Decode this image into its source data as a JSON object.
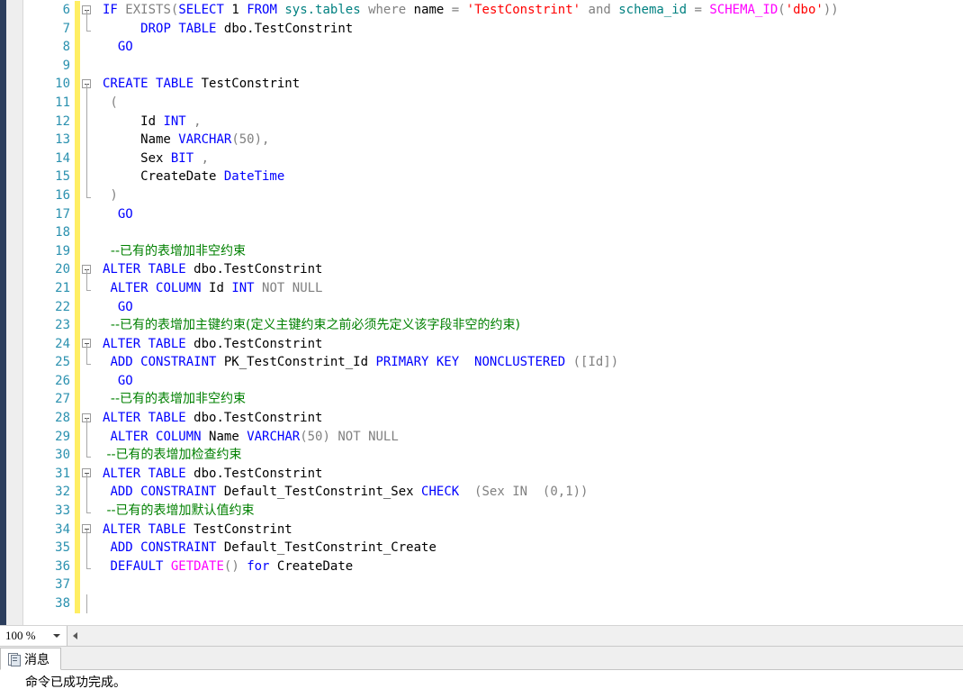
{
  "editor": {
    "first_line_number": 6,
    "gutter_change_color": "#ffee62",
    "line_number_color": "#2b91af",
    "colors": {
      "keyword": "#0000ff",
      "string": "#ff0000",
      "comment": "#008000",
      "function": "#ff00ff",
      "system_object": "#008080",
      "operator_gray": "#808080",
      "plain": "#000000"
    },
    "lines": [
      {
        "number": 6,
        "fold": "start",
        "tokens": [
          {
            "t": "IF ",
            "c": "kw"
          },
          {
            "t": "EXISTS(",
            "c": "gray"
          },
          {
            "t": "SELECT ",
            "c": "kw"
          },
          {
            "t": "1 ",
            "c": "plain"
          },
          {
            "t": "FROM ",
            "c": "kw"
          },
          {
            "t": "sys.tables ",
            "c": "sysobj"
          },
          {
            "t": "where ",
            "c": "gray"
          },
          {
            "t": "name ",
            "c": "plain"
          },
          {
            "t": "= ",
            "c": "gray"
          },
          {
            "t": "'TestConstrint' ",
            "c": "str"
          },
          {
            "t": "and ",
            "c": "gray"
          },
          {
            "t": "schema_id ",
            "c": "sysobj"
          },
          {
            "t": "= ",
            "c": "gray"
          },
          {
            "t": "SCHEMA_ID",
            "c": "fn"
          },
          {
            "t": "(",
            "c": "gray"
          },
          {
            "t": "'dbo'",
            "c": "str"
          },
          {
            "t": "))",
            "c": "gray"
          }
        ]
      },
      {
        "number": 7,
        "fold": "end",
        "tokens": [
          {
            "t": "     ",
            "c": "plain"
          },
          {
            "t": "DROP ",
            "c": "kw"
          },
          {
            "t": "TABLE ",
            "c": "kw"
          },
          {
            "t": "dbo.TestConstrint",
            "c": "plain"
          }
        ]
      },
      {
        "number": 8,
        "fold": "none",
        "tokens": [
          {
            "t": "  ",
            "c": "plain"
          },
          {
            "t": "GO",
            "c": "kw"
          }
        ]
      },
      {
        "number": 9,
        "fold": "none",
        "tokens": []
      },
      {
        "number": 10,
        "fold": "start",
        "tokens": [
          {
            "t": "CREATE ",
            "c": "kw"
          },
          {
            "t": "TABLE ",
            "c": "kw"
          },
          {
            "t": "TestConstrint",
            "c": "plain"
          }
        ]
      },
      {
        "number": 11,
        "fold": "bar",
        "tokens": [
          {
            "t": " (",
            "c": "gray"
          }
        ]
      },
      {
        "number": 12,
        "fold": "bar",
        "tokens": [
          {
            "t": "     Id ",
            "c": "plain"
          },
          {
            "t": "INT ",
            "c": "kw"
          },
          {
            "t": ",",
            "c": "gray"
          }
        ]
      },
      {
        "number": 13,
        "fold": "bar",
        "tokens": [
          {
            "t": "     Name ",
            "c": "plain"
          },
          {
            "t": "VARCHAR",
            "c": "kw"
          },
          {
            "t": "(50),",
            "c": "gray"
          }
        ]
      },
      {
        "number": 14,
        "fold": "bar",
        "tokens": [
          {
            "t": "     Sex ",
            "c": "plain"
          },
          {
            "t": "BIT ",
            "c": "kw"
          },
          {
            "t": ",",
            "c": "gray"
          }
        ]
      },
      {
        "number": 15,
        "fold": "bar",
        "tokens": [
          {
            "t": "     CreateDate ",
            "c": "plain"
          },
          {
            "t": "DateTime",
            "c": "kw"
          }
        ]
      },
      {
        "number": 16,
        "fold": "end",
        "tokens": [
          {
            "t": " )",
            "c": "gray"
          }
        ]
      },
      {
        "number": 17,
        "fold": "none",
        "tokens": [
          {
            "t": "  ",
            "c": "plain"
          },
          {
            "t": "GO",
            "c": "kw"
          }
        ]
      },
      {
        "number": 18,
        "fold": "none",
        "tokens": []
      },
      {
        "number": 19,
        "fold": "none",
        "tokens": [
          {
            "t": "  --已有的表增加非空约束",
            "c": "green cjk"
          }
        ]
      },
      {
        "number": 20,
        "fold": "start",
        "tokens": [
          {
            "t": "ALTER ",
            "c": "kw"
          },
          {
            "t": "TABLE ",
            "c": "kw"
          },
          {
            "t": "dbo.TestConstrint",
            "c": "plain"
          }
        ]
      },
      {
        "number": 21,
        "fold": "end",
        "tokens": [
          {
            "t": " ",
            "c": "plain"
          },
          {
            "t": "ALTER ",
            "c": "kw"
          },
          {
            "t": "COLUMN ",
            "c": "kw"
          },
          {
            "t": "Id ",
            "c": "plain"
          },
          {
            "t": "INT ",
            "c": "kw"
          },
          {
            "t": "NOT NULL",
            "c": "gray"
          }
        ]
      },
      {
        "number": 22,
        "fold": "none",
        "tokens": [
          {
            "t": "  ",
            "c": "plain"
          },
          {
            "t": "GO",
            "c": "kw"
          }
        ]
      },
      {
        "number": 23,
        "fold": "none",
        "tokens": [
          {
            "t": "  --已有的表增加主键约束(定义主键约束之前必须先定义该字段非空的约束)",
            "c": "green cjk"
          }
        ]
      },
      {
        "number": 24,
        "fold": "start",
        "tokens": [
          {
            "t": "ALTER ",
            "c": "kw"
          },
          {
            "t": "TABLE ",
            "c": "kw"
          },
          {
            "t": "dbo.TestConstrint",
            "c": "plain"
          }
        ]
      },
      {
        "number": 25,
        "fold": "end",
        "tokens": [
          {
            "t": " ",
            "c": "plain"
          },
          {
            "t": "ADD ",
            "c": "kw"
          },
          {
            "t": "CONSTRAINT ",
            "c": "kw"
          },
          {
            "t": "PK_TestConstrint_Id ",
            "c": "plain"
          },
          {
            "t": "PRIMARY KEY ",
            "c": "kw"
          },
          {
            "t": " ",
            "c": "plain"
          },
          {
            "t": "NONCLUSTERED ",
            "c": "kw"
          },
          {
            "t": "([Id])",
            "c": "gray"
          }
        ]
      },
      {
        "number": 26,
        "fold": "none",
        "tokens": [
          {
            "t": "  ",
            "c": "plain"
          },
          {
            "t": "GO",
            "c": "kw"
          }
        ]
      },
      {
        "number": 27,
        "fold": "none",
        "tokens": [
          {
            "t": "  --已有的表增加非空约束",
            "c": "green cjk"
          }
        ]
      },
      {
        "number": 28,
        "fold": "start",
        "tokens": [
          {
            "t": "ALTER ",
            "c": "kw"
          },
          {
            "t": "TABLE ",
            "c": "kw"
          },
          {
            "t": "dbo.TestConstrint",
            "c": "plain"
          }
        ]
      },
      {
        "number": 29,
        "fold": "bar",
        "tokens": [
          {
            "t": " ",
            "c": "plain"
          },
          {
            "t": "ALTER ",
            "c": "kw"
          },
          {
            "t": "COLUMN ",
            "c": "kw"
          },
          {
            "t": "Name ",
            "c": "plain"
          },
          {
            "t": "VARCHAR",
            "c": "kw"
          },
          {
            "t": "(50) ",
            "c": "gray"
          },
          {
            "t": "NOT NULL",
            "c": "gray"
          }
        ]
      },
      {
        "number": 30,
        "fold": "end",
        "tokens": [
          {
            "t": " --已有的表增加检查约束",
            "c": "green cjk"
          }
        ]
      },
      {
        "number": 31,
        "fold": "start",
        "tokens": [
          {
            "t": "ALTER ",
            "c": "kw"
          },
          {
            "t": "TABLE ",
            "c": "kw"
          },
          {
            "t": "dbo.TestConstrint",
            "c": "plain"
          }
        ]
      },
      {
        "number": 32,
        "fold": "bar",
        "tokens": [
          {
            "t": " ",
            "c": "plain"
          },
          {
            "t": "ADD ",
            "c": "kw"
          },
          {
            "t": "CONSTRAINT ",
            "c": "kw"
          },
          {
            "t": "Default_TestConstrint_Sex ",
            "c": "plain"
          },
          {
            "t": "CHECK ",
            "c": "kw"
          },
          {
            "t": " (Sex ",
            "c": "gray"
          },
          {
            "t": "IN ",
            "c": "gray"
          },
          {
            "t": " (0,1))",
            "c": "gray"
          }
        ]
      },
      {
        "number": 33,
        "fold": "end",
        "tokens": [
          {
            "t": " --已有的表增加默认值约束",
            "c": "green cjk"
          }
        ]
      },
      {
        "number": 34,
        "fold": "start",
        "tokens": [
          {
            "t": "ALTER ",
            "c": "kw"
          },
          {
            "t": "TABLE ",
            "c": "kw"
          },
          {
            "t": "TestConstrint",
            "c": "plain"
          }
        ]
      },
      {
        "number": 35,
        "fold": "bar",
        "tokens": [
          {
            "t": " ",
            "c": "plain"
          },
          {
            "t": "ADD ",
            "c": "kw"
          },
          {
            "t": "CONSTRAINT ",
            "c": "kw"
          },
          {
            "t": "Default_TestConstrint_Create",
            "c": "plain"
          }
        ]
      },
      {
        "number": 36,
        "fold": "end",
        "tokens": [
          {
            "t": " ",
            "c": "plain"
          },
          {
            "t": "DEFAULT ",
            "c": "kw"
          },
          {
            "t": "GETDATE",
            "c": "fn"
          },
          {
            "t": "() ",
            "c": "gray"
          },
          {
            "t": "for ",
            "c": "kw"
          },
          {
            "t": "CreateDate",
            "c": "plain"
          }
        ]
      },
      {
        "number": 37,
        "fold": "none",
        "tokens": []
      },
      {
        "number": 38,
        "fold": "bar",
        "tokens": []
      }
    ]
  },
  "zoom_bar": {
    "zoom_level": "100 %",
    "dropdown_icon": "chevron-down-icon",
    "scroll_left_icon": "scroll-left-arrow-icon"
  },
  "results": {
    "tabs": [
      {
        "label": "消息",
        "icon": "messages-icon",
        "active": true
      }
    ],
    "message_lines": [
      "命令已成功完成。"
    ]
  }
}
